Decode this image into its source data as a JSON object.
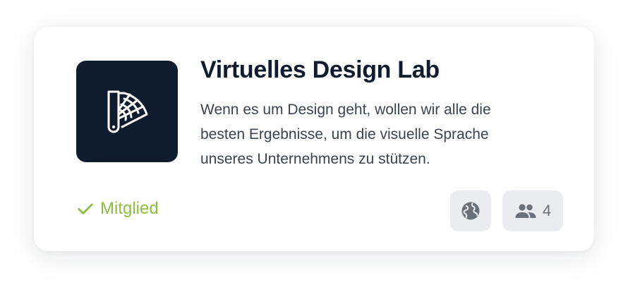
{
  "card": {
    "title": "Virtuelles Design Lab",
    "description": "Wenn es um Design geht, wollen wir alle die besten Ergebnisse, um die visuelle Sprache unseres Unternehmens zu stützen.",
    "logo_icon": "color-swatch-fan-icon",
    "status": {
      "label": "Mitglied",
      "icon": "check-icon",
      "color": "#8cbf3f"
    },
    "visibility_icon": "globe-icon",
    "members": {
      "icon": "people-icon",
      "count": "4"
    }
  },
  "colors": {
    "logo_background": "#0f1c2e",
    "title": "#0f1c2e",
    "text": "#3a4350",
    "chip_background": "#ebecf0",
    "chip_icon": "#6b717b"
  }
}
